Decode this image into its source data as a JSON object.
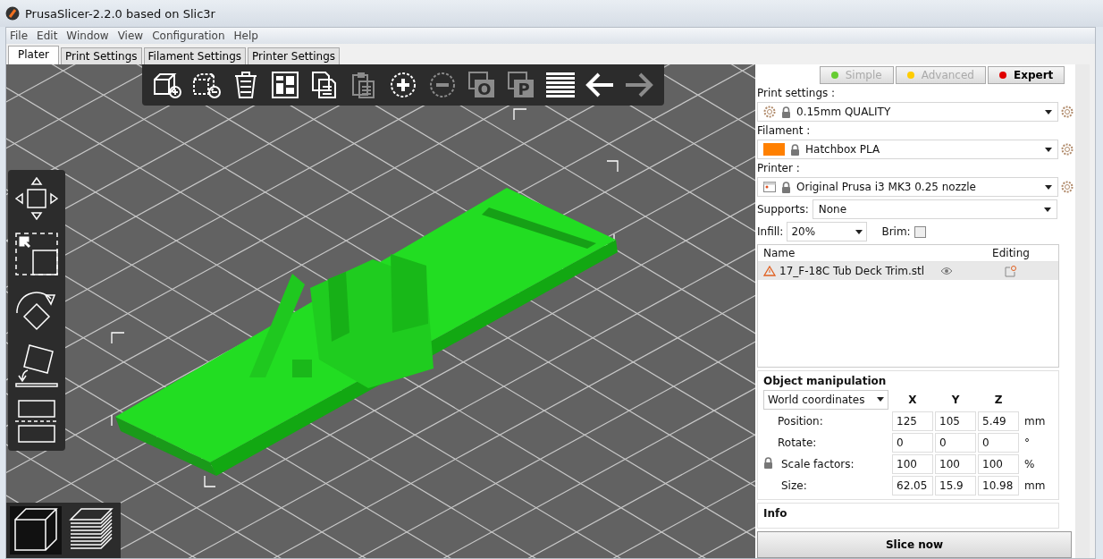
{
  "window": {
    "title": "PrusaSlicer-2.2.0 based on Slic3r"
  },
  "menu": [
    "File",
    "Edit",
    "Window",
    "View",
    "Configuration",
    "Help"
  ],
  "tabs": [
    {
      "label": "Plater",
      "selected": true
    },
    {
      "label": "Print Settings",
      "selected": false
    },
    {
      "label": "Filament Settings",
      "selected": false
    },
    {
      "label": "Printer Settings",
      "selected": false
    }
  ],
  "toolbar": [
    {
      "kind": "add",
      "disabled": false
    },
    {
      "kind": "remove",
      "disabled": false
    },
    {
      "kind": "delete",
      "disabled": false
    },
    {
      "kind": "arrange",
      "disabled": false
    },
    {
      "kind": "copy",
      "disabled": false
    },
    {
      "kind": "paste",
      "disabled": true
    },
    {
      "kind": "instance_add",
      "disabled": false
    },
    {
      "kind": "instance_remove",
      "disabled": true
    },
    {
      "kind": "split",
      "glyph": "O",
      "disabled": true
    },
    {
      "kind": "split",
      "glyph": "P",
      "disabled": true
    },
    {
      "kind": "layers",
      "disabled": false
    },
    {
      "kind": "undo",
      "disabled": false
    },
    {
      "kind": "redo",
      "disabled": true
    }
  ],
  "left_toolbar": [
    {
      "kind": "move"
    },
    {
      "kind": "scale"
    },
    {
      "kind": "rotate"
    },
    {
      "kind": "place"
    },
    {
      "kind": "cut"
    }
  ],
  "view_toggle": [
    {
      "kind": "model",
      "selected": true
    },
    {
      "kind": "preview",
      "selected": false
    }
  ],
  "modes": [
    {
      "label": "Simple",
      "color": "#66cc33",
      "selected": false
    },
    {
      "label": "Advanced",
      "color": "#ffcc00",
      "selected": false
    },
    {
      "label": "Expert",
      "color": "#e00000",
      "selected": true
    }
  ],
  "presets": [
    {
      "kind": "print",
      "label": "Print settings :",
      "value": "0.15mm QUALITY"
    },
    {
      "kind": "filament",
      "label": "Filament :",
      "value": "Hatchbox PLA",
      "color": "#ff8000"
    },
    {
      "kind": "printer",
      "label": "Printer :",
      "value": "Original Prusa i3 MK3 0.25 nozzle"
    }
  ],
  "supports": {
    "label": "Supports:",
    "value": "None"
  },
  "infill": {
    "label": "Infill:",
    "value": "20%"
  },
  "brim": {
    "label": "Brim:",
    "checked": false
  },
  "object_list": {
    "columns": [
      "Name",
      "Editing"
    ],
    "rows": [
      {
        "name": "17_F-18C Tub Deck Trim.stl",
        "warning": true,
        "selected": true
      }
    ]
  },
  "manipulation": {
    "title": "Object manipulation",
    "coordinates": "World coordinates",
    "axes": [
      "X",
      "Y",
      "Z"
    ],
    "scale_locked": true,
    "rows": [
      {
        "label": "Position:",
        "values": [
          "125",
          "105",
          "5.49"
        ],
        "unit": "mm"
      },
      {
        "label": "Rotate:",
        "values": [
          "0",
          "0",
          "0"
        ],
        "unit": "°"
      },
      {
        "label": "Scale factors:",
        "values": [
          "100",
          "100",
          "100"
        ],
        "unit": "%"
      },
      {
        "label": "Size:",
        "values": [
          "62.05",
          "15.9",
          "10.98"
        ],
        "unit": "mm"
      }
    ]
  },
  "info": {
    "title": "Info"
  },
  "slice_button": "Slice now"
}
